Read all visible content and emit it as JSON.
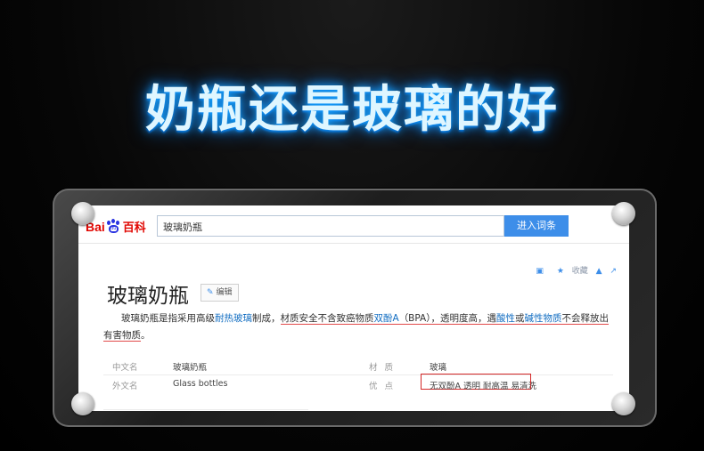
{
  "headline": "奶瓶还是玻璃的好",
  "header": {
    "logo_bai": "Bai",
    "logo_du": "du",
    "logo_baike": "百科",
    "search_value": "玻璃奶瓶",
    "search_button": "进入词条"
  },
  "tools": {
    "collect": "收藏"
  },
  "article": {
    "title": "玻璃奶瓶",
    "edit_label": "编辑",
    "summary_parts": {
      "p1": "玻璃奶瓶是指采用高级",
      "p2": "耐热玻璃",
      "p3": "制成，",
      "p4": "材质安全不含致癌物质",
      "p5": "双酚A",
      "p6": "（BPA），透明度高，遇",
      "p7": "酸性",
      "p8": "或",
      "p9": "碱性物质",
      "p10": "不会释放出有",
      "p11": "害物质",
      "p12": "。"
    }
  },
  "infobox": {
    "rows": [
      {
        "k1": "中文名",
        "v1": "玻璃奶瓶",
        "k2": "材质",
        "v2": "玻璃"
      },
      {
        "k1": "外文名",
        "v1": "Glass bottles",
        "k2": "优点",
        "v2": "无双酚A 透明 耐高温 易清洗"
      }
    ]
  },
  "colors": {
    "baidu_red": "#e10601",
    "baidu_blue": "#2932e1",
    "button_blue": "#3d8ee9",
    "link_blue": "#136ec2",
    "highlight_red": "#d42828"
  }
}
